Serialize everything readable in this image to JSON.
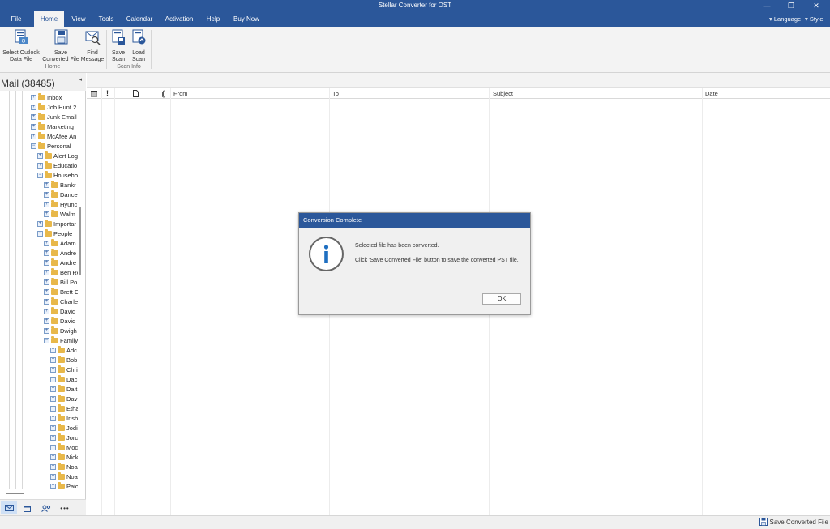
{
  "window": {
    "title": "Stellar Converter for OST",
    "minimize": "—",
    "restore": "❐",
    "close": "✕"
  },
  "menu": {
    "items": [
      "File",
      "Home",
      "View",
      "Tools",
      "Calendar",
      "Activation",
      "Help",
      "Buy Now"
    ],
    "active": "Home",
    "language": "Language",
    "style": "Style"
  },
  "ribbon": {
    "buttons": [
      {
        "line1": "Select Outlook",
        "line2": "Data File",
        "icon": "open-file-icon"
      },
      {
        "line1": "Save",
        "line2": "Converted File",
        "icon": "save-icon"
      },
      {
        "line1": "Find",
        "line2": "Message",
        "icon": "find-message-icon"
      },
      {
        "line1": "Save",
        "line2": "Scan",
        "icon": "save-scan-icon"
      },
      {
        "line1": "Load",
        "line2": "Scan",
        "icon": "load-scan-icon"
      }
    ],
    "groups": [
      "Home",
      "Scan Info"
    ]
  },
  "sidebar": {
    "header": "Mail (38485)",
    "tree": [
      {
        "label": "Inbox",
        "level": 1,
        "exp": "+"
      },
      {
        "label": "Job Hunt 2",
        "level": 1,
        "exp": "+"
      },
      {
        "label": "Junk Email",
        "level": 1,
        "exp": "+"
      },
      {
        "label": "Marketing",
        "level": 1,
        "exp": "+"
      },
      {
        "label": "McAfee An",
        "level": 1,
        "exp": "+"
      },
      {
        "label": "Personal",
        "level": 1,
        "exp": "−"
      },
      {
        "label": "Alert Log",
        "level": 2,
        "exp": "+"
      },
      {
        "label": "Educatio",
        "level": 2,
        "exp": "+"
      },
      {
        "label": "Househo",
        "level": 2,
        "exp": "−"
      },
      {
        "label": "Bankr",
        "level": 3,
        "exp": "+"
      },
      {
        "label": "Dance",
        "level": 3,
        "exp": "+"
      },
      {
        "label": "Hyunc",
        "level": 3,
        "exp": "+"
      },
      {
        "label": "Walm",
        "level": 3,
        "exp": "+"
      },
      {
        "label": "Importar",
        "level": 2,
        "exp": "+"
      },
      {
        "label": "People",
        "level": 2,
        "exp": "−"
      },
      {
        "label": "Adam",
        "level": 3,
        "exp": "+"
      },
      {
        "label": "Andre",
        "level": 3,
        "exp": "+"
      },
      {
        "label": "Andre",
        "level": 3,
        "exp": "+"
      },
      {
        "label": "Ben Re",
        "level": 3,
        "exp": "+"
      },
      {
        "label": "Bill Po",
        "level": 3,
        "exp": "+"
      },
      {
        "label": "Brett C",
        "level": 3,
        "exp": "+"
      },
      {
        "label": "Charle",
        "level": 3,
        "exp": "+"
      },
      {
        "label": "David",
        "level": 3,
        "exp": "+"
      },
      {
        "label": "David",
        "level": 3,
        "exp": "+"
      },
      {
        "label": "Dwigh",
        "level": 3,
        "exp": "+"
      },
      {
        "label": "Family",
        "level": 3,
        "exp": "−"
      },
      {
        "label": "Adc",
        "level": 4,
        "exp": "+"
      },
      {
        "label": "Bob",
        "level": 4,
        "exp": "+"
      },
      {
        "label": "Chri",
        "level": 4,
        "exp": "+"
      },
      {
        "label": "Dac",
        "level": 4,
        "exp": "+"
      },
      {
        "label": "Dalt",
        "level": 4,
        "exp": "+"
      },
      {
        "label": "Dav",
        "level": 4,
        "exp": "+"
      },
      {
        "label": "Etha",
        "level": 4,
        "exp": "+"
      },
      {
        "label": "Irish",
        "level": 4,
        "exp": "+"
      },
      {
        "label": "Jodi",
        "level": 4,
        "exp": "+"
      },
      {
        "label": "Jorc",
        "level": 4,
        "exp": "+"
      },
      {
        "label": "Moc",
        "level": 4,
        "exp": "+"
      },
      {
        "label": "Nick",
        "level": 4,
        "exp": "+"
      },
      {
        "label": "Noa",
        "level": 4,
        "exp": "+"
      },
      {
        "label": "Noa",
        "level": 4,
        "exp": "+"
      },
      {
        "label": "Paic",
        "level": 4,
        "exp": "+"
      }
    ],
    "nav": [
      "mail-icon",
      "calendar-icon",
      "contacts-icon",
      "more-icon"
    ],
    "nav_more": "•••",
    "collapse_glyph": "◂"
  },
  "list": {
    "columns": {
      "delete_icon": "trash-icon",
      "importance": "!",
      "from": "From",
      "to": "To",
      "subject": "Subject",
      "date": "Date"
    }
  },
  "dialog": {
    "title": "Conversion Complete",
    "icon_glyph": "i",
    "message1": "Selected file has been converted.",
    "message2": "Click 'Save Converted File' button to save the converted PST file.",
    "ok_label": "OK"
  },
  "status": {
    "save_label": "Save Converted File"
  },
  "colors": {
    "accent": "#2b579a",
    "folder": "#e8b84a",
    "info_icon": "#1f6fc1"
  }
}
